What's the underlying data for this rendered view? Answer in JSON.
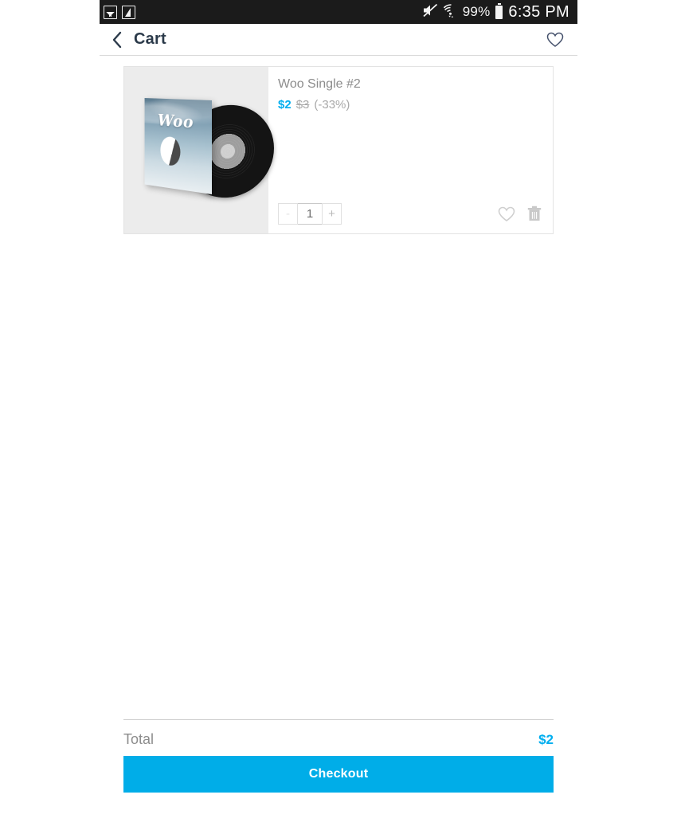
{
  "statusbar": {
    "notification_icons": [
      "image-icon",
      "screenshot-icon"
    ],
    "mute_icon": "volume-muted-icon",
    "wifi_icon": "wifi-icon",
    "battery_percent": "99%",
    "battery_icon": "battery-full-icon",
    "time": "6:35 PM",
    "background": "#1b1b1b"
  },
  "appbar": {
    "back_icon": "chevron-left-icon",
    "title": "Cart",
    "wishlist_icon": "heart-outline-icon",
    "title_color": "#2b3a4a"
  },
  "cart": {
    "items": [
      {
        "title": "Woo Single #2",
        "price": "$2",
        "original_price": "$3",
        "discount": "(-33%)",
        "quantity": "1",
        "decrement_label": "-",
        "increment_label": "+",
        "image_word": "Woo",
        "image_alt": "vinyl-record-album",
        "save_icon": "heart-outline-icon",
        "delete_icon": "trash-icon"
      }
    ]
  },
  "summary": {
    "total_label": "Total",
    "total_value": "$2",
    "checkout_label": "Checkout"
  },
  "colors": {
    "accent": "#00aeef",
    "checkout_button": "#00ade8",
    "muted_text": "#8c8c8c",
    "card_border": "#e3e3e3",
    "image_panel": "#ececec"
  }
}
